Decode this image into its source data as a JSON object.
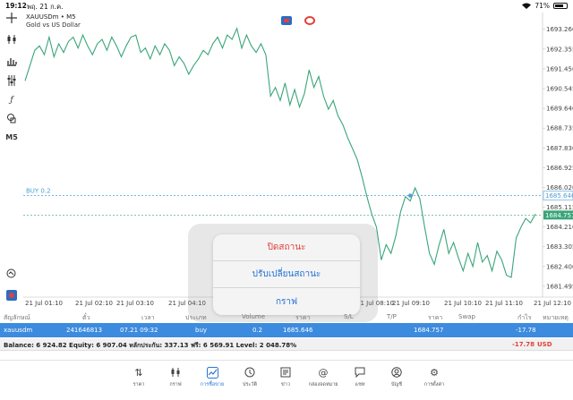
{
  "status_bar": {
    "time": "19:12",
    "date": "พฤ. 21 ก.ค.",
    "battery": "71%",
    "battery_level": 0.71
  },
  "chart": {
    "symbol": "XAUUSDm • M5",
    "description": "Gold vs US Dollar",
    "timeframe_label": "M5",
    "line_color": "#3aa57a",
    "price_levels": [
      "1693.260",
      "1692.355",
      "1691.450",
      "1690.545",
      "1689.640",
      "1688.735",
      "1687.830",
      "1686.925",
      "1686.020",
      "1685.115",
      "1684.210",
      "1683.305",
      "1682.400",
      "1681.495"
    ],
    "time_labels": [
      "21 Jul 01:10",
      "21 Jul 02:10",
      "21 Jul 03:10",
      "21 Jul 04:10",
      "21 Jul 08:10",
      "21 Jul 09:10",
      "21 Jul 10:10",
      "21 Jul 11:10",
      "21 Jul 12:10"
    ],
    "buy_label": "BUY 0.2",
    "buy_price": "1685.646",
    "current_price": "1684.757",
    "buy_line_color": "#4a9fd6",
    "bid_line_color": "#3aa57a"
  },
  "chart_data": {
    "type": "line",
    "series": [
      {
        "values": [
          1690.9,
          1691.6,
          1692.3,
          1692.5,
          1692.1,
          1692.9,
          1692.0,
          1692.6,
          1692.2,
          1692.7,
          1692.9,
          1692.4,
          1693.0,
          1692.5,
          1692.1,
          1692.6,
          1692.8,
          1692.3,
          1692.9,
          1692.5,
          1692.0,
          1692.5,
          1692.9,
          1693.0,
          1692.2,
          1692.4,
          1691.9,
          1692.5,
          1692.1,
          1692.6,
          1692.3,
          1691.6,
          1692.0,
          1691.7,
          1691.2,
          1691.6,
          1691.9,
          1692.3,
          1692.1,
          1692.6,
          1692.9,
          1692.4,
          1693.0,
          1692.8,
          1693.3,
          1692.4,
          1693.0,
          1692.5,
          1692.2,
          1692.6,
          1692.1,
          1690.2,
          1690.6,
          1690.0,
          1690.8,
          1689.8,
          1690.5,
          1689.7,
          1690.3,
          1691.4,
          1690.6,
          1691.1,
          1690.2,
          1689.6,
          1690.0,
          1689.3,
          1688.9,
          1688.3,
          1687.8,
          1687.3,
          1686.5,
          1685.6,
          1684.8,
          1684.2,
          1682.7,
          1683.4,
          1683.0,
          1683.8,
          1684.9,
          1685.6,
          1685.4,
          1686.0,
          1685.5,
          1684.2,
          1683.0,
          1682.5,
          1683.4,
          1684.1,
          1683.0,
          1683.5,
          1682.8,
          1682.2,
          1683.0,
          1682.4,
          1683.5,
          1682.6,
          1682.9,
          1682.2,
          1683.1,
          1682.7,
          1682.0,
          1681.9,
          1683.7,
          1684.2,
          1684.6,
          1684.4,
          1684.8
        ]
      }
    ],
    "ylim": [
      1681.0,
      1693.7
    ],
    "grid": true
  },
  "menu": {
    "items": [
      {
        "label": "ปิดสถานะ",
        "style": "danger"
      },
      {
        "label": "ปรับเปลี่ยนสถานะ",
        "style": "normal"
      },
      {
        "label": "กราฟ",
        "style": "normal"
      }
    ]
  },
  "table": {
    "headers": [
      "สัญลักษณ์",
      "ตั๋ว",
      "เวลา",
      "ประเภท",
      "Volume",
      "ราคา",
      "S/L",
      "T/P",
      "ราคา",
      "Swap",
      "กำไร",
      "หมายเหตุ"
    ],
    "row": {
      "symbol": "xauusdm",
      "ticket": "241646813",
      "time": "07.21 09:32",
      "type": "buy",
      "volume": "0.2",
      "open_price": "1685.646",
      "current_price": "1684.757",
      "profit": "-17.78"
    },
    "balance_text": "Balance: 6 924.82 Equity: 6 907.04 หลักประกัน: 337.13 ฟรี: 6 569.91 Level: 2 048.78%",
    "total_profit": "-17.78",
    "currency": "USD"
  },
  "bottom_nav": {
    "items": [
      {
        "label": "ราคา",
        "icon": "quotes-icon"
      },
      {
        "label": "กราฟ",
        "icon": "chart-icon"
      },
      {
        "label": "การซื้อขาย",
        "icon": "trade-icon",
        "active": true
      },
      {
        "label": "ประวัติ",
        "icon": "history-icon"
      },
      {
        "label": "ข่าว",
        "icon": "news-icon"
      },
      {
        "label": "กล่องจดหมาย",
        "icon": "mailbox-icon"
      },
      {
        "label": "แชท",
        "icon": "chat-icon"
      },
      {
        "label": "บัญชี",
        "icon": "account-icon"
      },
      {
        "label": "การตั้งค่า",
        "icon": "settings-icon"
      }
    ]
  }
}
